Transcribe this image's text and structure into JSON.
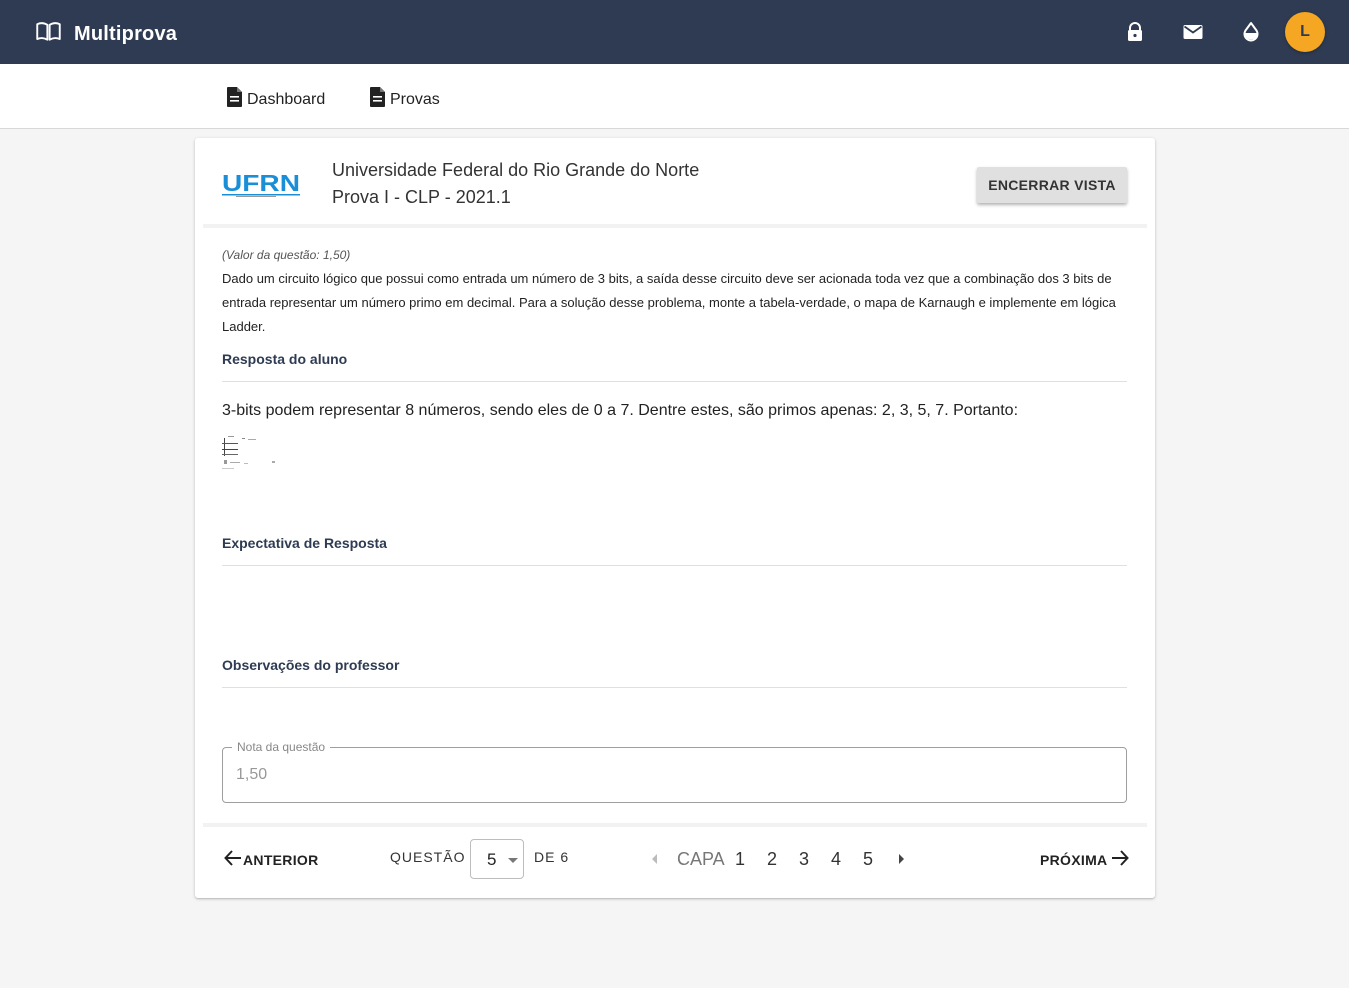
{
  "app": {
    "title": "Multiprova",
    "avatar_initial": "L",
    "accent_color": "#2e3b52",
    "avatar_color": "#f5a623"
  },
  "topbar_icons": [
    "lock-icon",
    "mail-icon",
    "drop-icon"
  ],
  "nav": {
    "items": [
      {
        "label": "Dashboard",
        "icon": "document-icon"
      },
      {
        "label": "Provas",
        "icon": "document-icon"
      }
    ]
  },
  "header": {
    "institution": "Universidade Federal do Rio Grande do Norte",
    "exam_title": "Prova I - CLP - 2021.1",
    "end_button": "ENCERRAR VISTA",
    "logo_text": "UFRN"
  },
  "question": {
    "value_label": "(Valor da questão: 1,50)",
    "text": "Dado um circuito lógico que possui como entrada um número de 3 bits, a saída desse circuito deve ser acionada toda vez que a combinação dos 3 bits de entrada representar um número primo em decimal. Para a solução desse problema, monte a tabela-verdade, o mapa de Karnaugh e implemente em lógica Ladder."
  },
  "sections": {
    "student_answer_title": "Resposta do aluno",
    "student_answer_text": "3-bits podem representar 8 números, sendo eles de 0 a 7. Dentre estes, são primos apenas: 2, 3, 5, 7. Portanto:",
    "expected_title": "Expectativa de Resposta",
    "observations_title": "Observações do professor"
  },
  "grade": {
    "label": "Nota da questão",
    "value": "1,50"
  },
  "footer": {
    "prev_label": "ANTERIOR",
    "next_label": "PRÓXIMA",
    "question_label": "QUESTÃO",
    "selected_question": "5",
    "of_label": "DE 6",
    "pages": [
      "CAPA",
      "1",
      "2",
      "3",
      "4",
      "5"
    ]
  }
}
